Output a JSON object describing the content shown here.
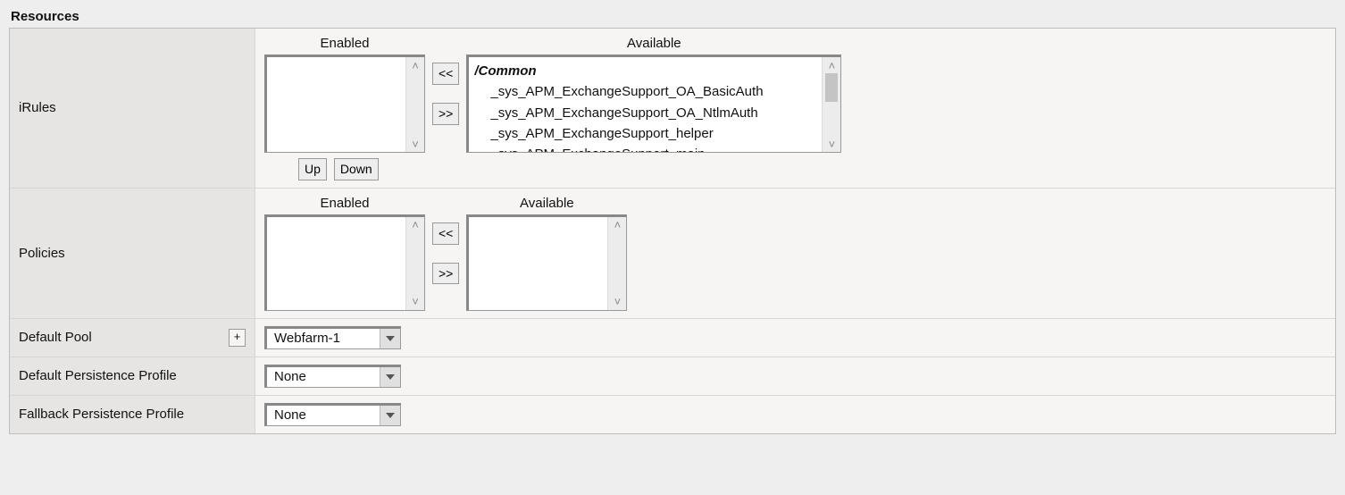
{
  "section_title": "Resources",
  "irules": {
    "label": "iRules",
    "enabled_header": "Enabled",
    "available_header": "Available",
    "move_left": "<<",
    "move_right": ">>",
    "up_label": "Up",
    "down_label": "Down",
    "available_partition": "/Common",
    "available_items": [
      "_sys_APM_ExchangeSupport_OA_BasicAuth",
      "_sys_APM_ExchangeSupport_OA_NtlmAuth",
      "_sys_APM_ExchangeSupport_helper",
      "_sys_APM_ExchangeSupport_main"
    ]
  },
  "policies": {
    "label": "Policies",
    "enabled_header": "Enabled",
    "available_header": "Available",
    "move_left": "<<",
    "move_right": ">>"
  },
  "default_pool": {
    "label": "Default Pool",
    "plus": "+",
    "value": "Webfarm-1"
  },
  "default_persist": {
    "label": "Default Persistence Profile",
    "value": "None"
  },
  "fallback_persist": {
    "label": "Fallback Persistence Profile",
    "value": "None"
  }
}
